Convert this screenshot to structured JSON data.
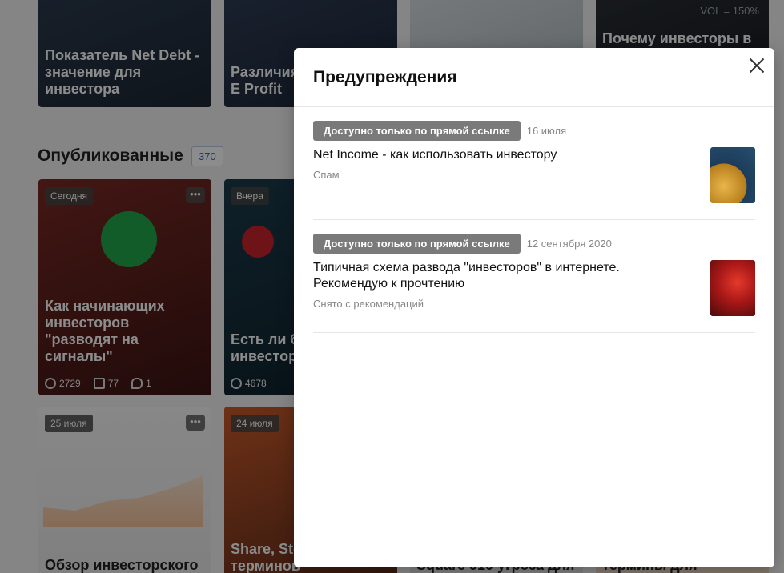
{
  "background": {
    "top_cards": [
      {
        "title": "Показатель Net Debt - значение для инвестора"
      },
      {
        "title": "Различия Net Income, E Profit"
      },
      {
        "title": ""
      },
      {
        "title": "Почему инвесторы в",
        "overlay_text": "VOL = 150%"
      }
    ],
    "section": {
      "title": "Опубликованные",
      "count": "370"
    },
    "published_cards": [
      {
        "date": "Сегодня",
        "title": "Как начинающих инвесторов \"разводят на сигналы\"",
        "views": "2729",
        "reads": "77",
        "comments": "1"
      },
      {
        "date": "Вчера",
        "title": "Есть ли б стоит чит инвестор",
        "views": "4678"
      },
      {
        "date": "25 июля",
        "title": "Обзор инвесторского"
      },
      {
        "date": "24 июля",
        "title": "Share, Sto значение терминов"
      },
      {
        "title": "Square 910 угроза для"
      },
      {
        "title": "термины для"
      }
    ]
  },
  "modal": {
    "title": "Предупреждения",
    "items": [
      {
        "badge": "Доступно только по прямой ссылке",
        "date": "16 июля",
        "title": "Net Income - как использовать инвестору",
        "status": "Спам",
        "thumb_color": "#c9962f"
      },
      {
        "badge": "Доступно только по прямой ссылке",
        "date": "12 сентября 2020",
        "title": "Типичная схема развода \"инвесторов\" в интернете. Рекомендую к прочтению",
        "status": "Снято с рекомендаций",
        "thumb_color": "#a81818"
      }
    ]
  }
}
